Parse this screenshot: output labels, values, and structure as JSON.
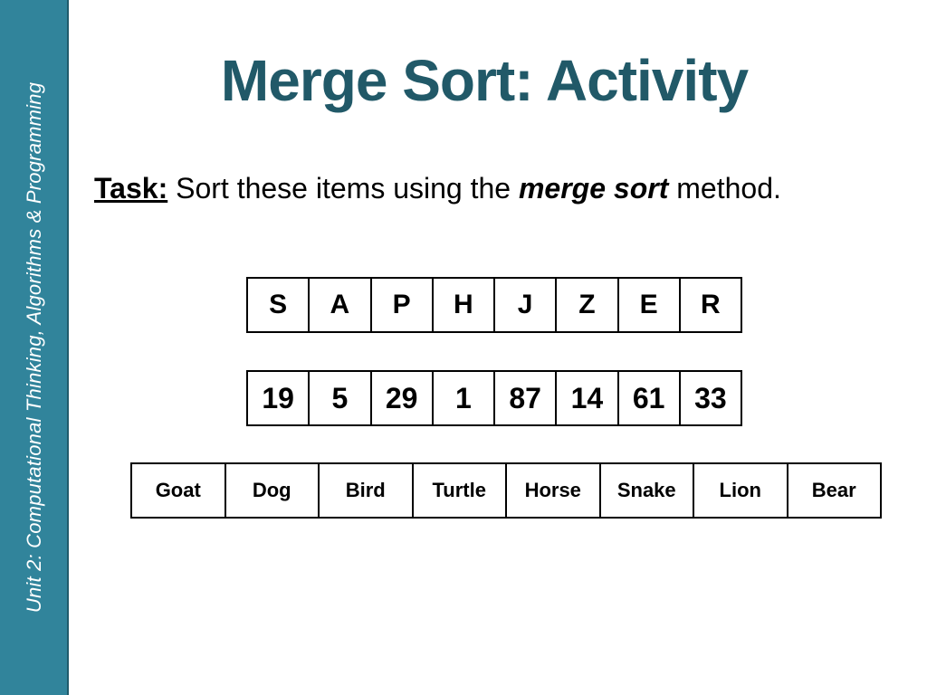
{
  "sidebar": {
    "text": "Unit 2: Computational Thinking, Algorithms & Programming",
    "color": "#31849b"
  },
  "slide": {
    "title": "Merge Sort: Activity",
    "task": {
      "label": "Task:",
      "text_before": " Sort these items using the ",
      "emphasis": "merge sort",
      "text_after": " method."
    }
  },
  "lists": {
    "letters": [
      "S",
      "A",
      "P",
      "H",
      "J",
      "Z",
      "E",
      "R"
    ],
    "numbers": [
      "19",
      "5",
      "29",
      "1",
      "87",
      "14",
      "61",
      "33"
    ],
    "animals": [
      "Goat",
      "Dog",
      "Bird",
      "Turtle",
      "Horse",
      "Snake",
      "Lion",
      "Bear"
    ]
  }
}
